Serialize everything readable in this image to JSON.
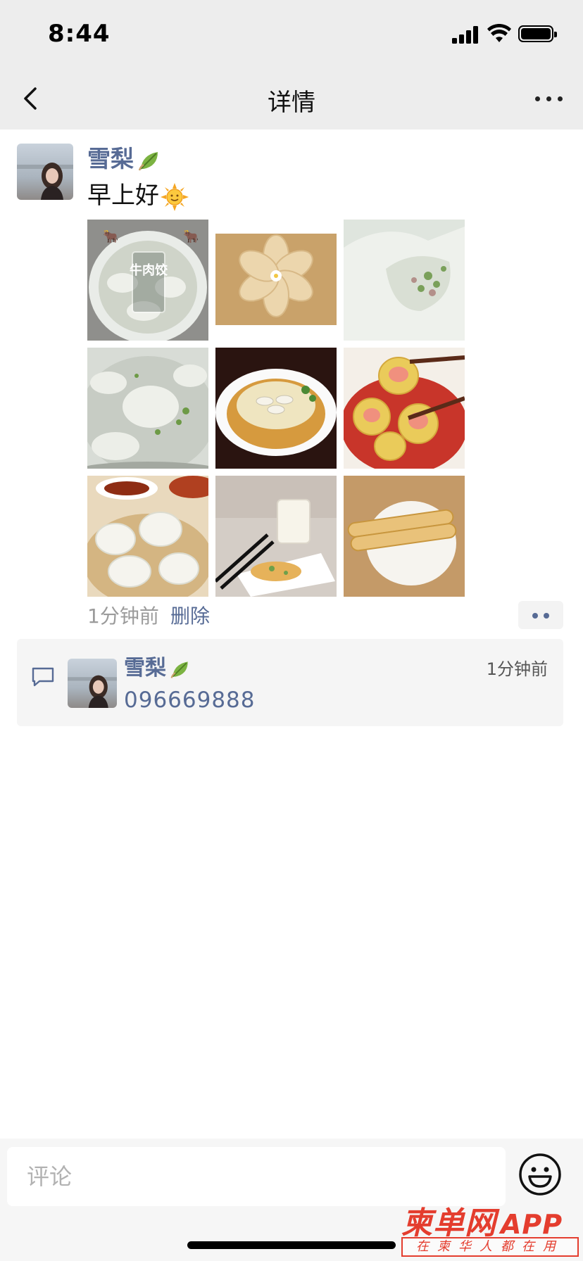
{
  "status_bar": {
    "time": "8:44"
  },
  "nav": {
    "title": "详情"
  },
  "post": {
    "author": "雪梨",
    "text": "早上好",
    "photo_labels": [
      "牛肉饺"
    ],
    "time": "1分钟前",
    "delete_label": "删除"
  },
  "comment": {
    "author": "雪梨",
    "text": "096669888",
    "time": "1分钟前"
  },
  "input": {
    "placeholder": "评论"
  },
  "watermark": {
    "logo": "柬单网",
    "app": "APP",
    "slogan": "在柬华人都在用"
  },
  "colors": {
    "link": "#576b95",
    "nav_bg": "#ededed",
    "comment_bg": "#f5f5f5",
    "watermark": "#e43d2e"
  }
}
